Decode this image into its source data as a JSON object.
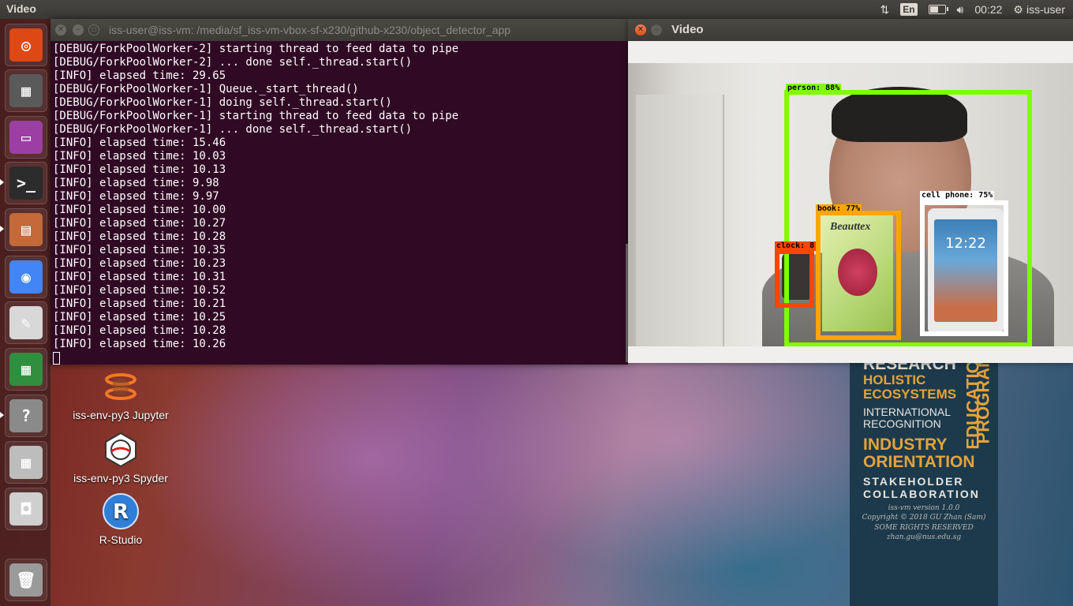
{
  "top_panel": {
    "app_title": "Video",
    "keyboard_layout": "En",
    "clock": "00:22",
    "username": "iss-user",
    "battery_level": 0.7
  },
  "launcher": {
    "items": [
      {
        "name": "ubuntu-dash-icon",
        "color": "#dd4814"
      },
      {
        "name": "workspace-switcher-icon",
        "color": "#5a5a5a"
      },
      {
        "name": "video-app-icon",
        "color": "#9b3fa5"
      },
      {
        "name": "terminal-icon",
        "color": "#2c2c2c"
      },
      {
        "name": "file-manager-icon",
        "color": "#c4693a"
      },
      {
        "name": "chrome-icon",
        "color": "#4285f4"
      },
      {
        "name": "text-editor-icon",
        "color": "#d8d8d8"
      },
      {
        "name": "spreadsheet-icon",
        "color": "#2f8f3f"
      },
      {
        "name": "help-icon",
        "color": "#8a8a8a"
      },
      {
        "name": "calculator-icon",
        "color": "#bdbdbd"
      },
      {
        "name": "camera-icon",
        "color": "#cfcfcf"
      },
      {
        "name": "trash-icon",
        "color": "#9a9a9a"
      }
    ]
  },
  "terminal": {
    "title": "iss-user@iss-vm: /media/sf_iss-vm-vbox-sf-x230/github-x230/object_detector_app",
    "lines": [
      "[DEBUG/ForkPoolWorker-2] starting thread to feed data to pipe",
      "[DEBUG/ForkPoolWorker-2] ... done self._thread.start()",
      "[INFO] elapsed time: 29.65",
      "[DEBUG/ForkPoolWorker-1] Queue._start_thread()",
      "[DEBUG/ForkPoolWorker-1] doing self._thread.start()",
      "[DEBUG/ForkPoolWorker-1] starting thread to feed data to pipe",
      "[DEBUG/ForkPoolWorker-1] ... done self._thread.start()",
      "[INFO] elapsed time: 15.46",
      "[INFO] elapsed time: 10.03",
      "[INFO] elapsed time: 10.13",
      "[INFO] elapsed time: 9.98",
      "[INFO] elapsed time: 9.97",
      "[INFO] elapsed time: 10.00",
      "[INFO] elapsed time: 10.27",
      "[INFO] elapsed time: 10.28",
      "[INFO] elapsed time: 10.35",
      "[INFO] elapsed time: 10.23",
      "[INFO] elapsed time: 10.31",
      "[INFO] elapsed time: 10.52",
      "[INFO] elapsed time: 10.21",
      "[INFO] elapsed time: 10.25",
      "[INFO] elapsed time: 10.28",
      "[INFO] elapsed time: 10.26"
    ]
  },
  "video_window": {
    "title": "Video",
    "phone_screen_time": "12:22",
    "book_brand": "Beauttex",
    "detections": [
      {
        "label": "person: 88%",
        "color": "#7fff00"
      },
      {
        "label": "cell phone: 75%",
        "color": "#ffffff"
      },
      {
        "label": "book: 77%",
        "color": "#ffa500"
      },
      {
        "label": "clock: 8",
        "color": "#ff4500"
      }
    ]
  },
  "desktop_icons": [
    {
      "label": "iss-env-py3 Jupyter",
      "icon": "jupyter-icon"
    },
    {
      "label": "iss-env-py3 Spyder",
      "icon": "spyder-icon"
    },
    {
      "label": "R-Studio",
      "icon": "rstudio-icon"
    }
  ],
  "wallpaper": {
    "lines": [
      {
        "text": "RESEARCH",
        "color": "#e0ddd5"
      },
      {
        "text": "HOLISTIC",
        "color": "#e4a33a"
      },
      {
        "text": "ECOSYSTEMS",
        "color": "#e4a33a"
      },
      {
        "text": "INTERNATIONAL",
        "color": "#e8e6e0"
      },
      {
        "text": "RECOGNITION",
        "color": "#e8e6e0"
      },
      {
        "text": "INDUSTRY",
        "color": "#e4a33a"
      },
      {
        "text": "ORIENTATION",
        "color": "#e4a33a"
      },
      {
        "text": "STAKEHOLDER",
        "color": "#e8e6e0"
      },
      {
        "text": "COLLABORATION",
        "color": "#e8e6e0"
      }
    ],
    "side_text_1": "EDUCATION",
    "side_text_2": "PROGRAM",
    "footer": [
      "iss-vm version 1.0.0",
      "Copyright © 2018 GU Zhan (Sam)",
      "SOME RIGHTS RESERVED",
      "zhan.gu@nus.edu.sg"
    ]
  }
}
